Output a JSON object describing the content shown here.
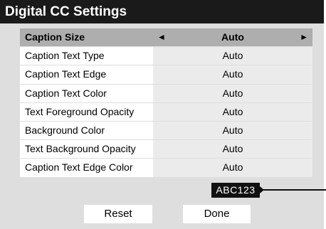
{
  "title": "Digital CC Settings",
  "settings": [
    {
      "label": "Caption Size",
      "value": "Auto"
    },
    {
      "label": "Caption Text Type",
      "value": "Auto"
    },
    {
      "label": "Caption Text Edge",
      "value": "Auto"
    },
    {
      "label": "Caption Text Color",
      "value": "Auto"
    },
    {
      "label": "Text Foreground Opacity",
      "value": "Auto"
    },
    {
      "label": "Background Color",
      "value": "Auto"
    },
    {
      "label": "Text Background Opacity",
      "value": "Auto"
    },
    {
      "label": "Caption Text Edge Color",
      "value": "Auto"
    }
  ],
  "arrows": {
    "left": "◄",
    "right": "►"
  },
  "sample_text": "ABC123",
  "buttons": {
    "reset": "Reset",
    "done": "Done"
  },
  "colors": {
    "title_bg": "#1a1a1a",
    "panel_bg": "#dedede",
    "selected_row": "#aeaeae"
  }
}
